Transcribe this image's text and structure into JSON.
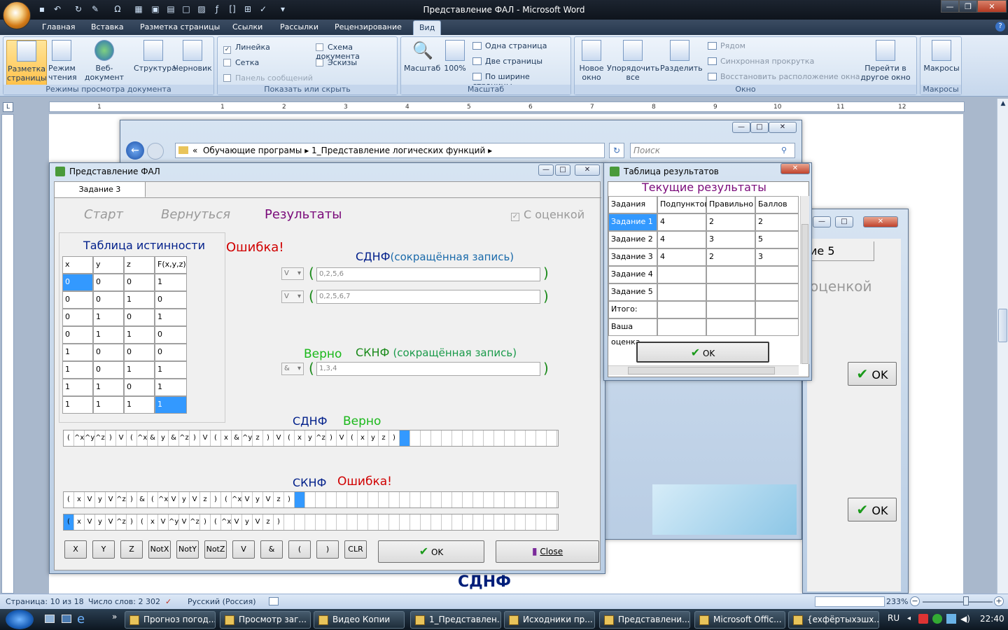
{
  "word": {
    "title": "Представление ФАЛ - Microsoft Word",
    "tabs": [
      "Главная",
      "Вставка",
      "Разметка страницы",
      "Ссылки",
      "Рассылки",
      "Рецензирование",
      "Вид"
    ],
    "selected_tab": "Вид",
    "groups": {
      "views": {
        "label": "Режимы просмотра документа",
        "buttons": [
          "Разметка страницы",
          "Режим чтения",
          "Веб-документ",
          "Структура",
          "Черновик"
        ]
      },
      "show": {
        "label": "Показать или скрыть",
        "items": [
          "Линейка",
          "Сетка",
          "Панель сообщений",
          "Схема документа",
          "Эскизы"
        ]
      },
      "zoom": {
        "label": "Масштаб",
        "zoom_btn": "Масштаб",
        "pct_btn": "100%",
        "one_page": "Одна страница",
        "two_pages": "Две страницы",
        "page_width": "По ширине страницы"
      },
      "window": {
        "label": "Окно",
        "new": "Новое окно",
        "arrange": "Упорядочить все",
        "split": "Разделить",
        "side": "Рядом",
        "sync": "Синхронная прокрутка",
        "reset": "Восстановить расположение окна",
        "switch": "Перейти в другое окно"
      },
      "macros": {
        "label": "Макросы",
        "btn": "Макросы"
      }
    },
    "ruler_numbers": [
      "1",
      "1",
      "2",
      "3",
      "4",
      "5",
      "6",
      "7",
      "8",
      "9",
      "10",
      "11",
      "12"
    ],
    "doc_text": "СДНФ",
    "status": {
      "page": "Страница: 10 из 18",
      "words": "Число слов: 2 302",
      "lang": "Русский (Россия)",
      "zoom": "233%"
    }
  },
  "explorer": {
    "crumbs": [
      "«",
      "Обучающие програмы",
      "1_Представление логических функций"
    ],
    "search_placeholder": "Поиск"
  },
  "back_window": {
    "tab_label": "ие 5",
    "check_label": "оценкой",
    "ok1": "OK",
    "ok2": "OK"
  },
  "fal": {
    "title": "Представление ФАЛ",
    "tab": "Задание 3",
    "nav": {
      "start": "Старт",
      "back": "Вернуться",
      "results": "Результаты",
      "rating": "С оценкой"
    },
    "truth_title": "Таблица истинности",
    "error_top": "Ошибка!",
    "headers": [
      "x",
      "y",
      "z",
      "F(x,y,z)"
    ],
    "rows": [
      [
        "0",
        "0",
        "0",
        "1"
      ],
      [
        "0",
        "0",
        "1",
        "0"
      ],
      [
        "0",
        "1",
        "0",
        "1"
      ],
      [
        "0",
        "1",
        "1",
        "0"
      ],
      [
        "1",
        "0",
        "0",
        "0"
      ],
      [
        "1",
        "0",
        "1",
        "1"
      ],
      [
        "1",
        "1",
        "0",
        "1"
      ],
      [
        "1",
        "1",
        "1",
        "1"
      ]
    ],
    "sdnf_label": "СДНФ",
    "short_note": "(сокращённая запись)",
    "sdnf_op1": "V",
    "sdnf_val1": "0,2,5,6",
    "sdnf_op2": "V",
    "sdnf_val2": "0,2,5,6,7",
    "correct1": "Верно",
    "sknf_label": "СКНФ",
    "sknf_op": "&",
    "sknf_val": "1,3,4",
    "row_sdnf_label": "СДНФ",
    "row_sdnf_status": "Верно",
    "row_sdnf": [
      "(",
      "^x",
      "^y",
      "^z",
      ")",
      "V",
      "(",
      "^x",
      "&",
      "y",
      "&",
      "^z",
      ")",
      "V",
      "(",
      "x",
      "&",
      "^y",
      "z",
      ")",
      "V",
      "(",
      "x",
      "y",
      "^z",
      ")",
      "V",
      "(",
      "x",
      "y",
      "z",
      ")"
    ],
    "row_sknf_label": "СКНФ",
    "row_sknf_status": "Ошибка!",
    "row_sknf1": [
      "(",
      "x",
      "V",
      "y",
      "V",
      "^z",
      ")",
      "&",
      "(",
      "^x",
      "V",
      "y",
      "V",
      "z",
      ")",
      "(",
      "^x",
      "V",
      "y",
      "V",
      "z",
      ")"
    ],
    "row_sknf2": [
      "(",
      "x",
      "V",
      "y",
      "V",
      "^z",
      ")",
      "(",
      "x",
      "V",
      "^y",
      "V",
      "^z",
      ")",
      "(",
      "^x",
      "V",
      "y",
      "V",
      "z",
      ")"
    ],
    "keys": [
      "X",
      "Y",
      "Z",
      "NotX",
      "NotY",
      "NotZ",
      "V",
      "&",
      "(",
      ")",
      "CLR"
    ],
    "ok": "OK",
    "close": "Close"
  },
  "results": {
    "title": "Таблица результатов",
    "heading": "Текущие результаты",
    "headers": [
      "Задания",
      "Подпунктов",
      "Правильно",
      "Баллов"
    ],
    "rows": [
      [
        "Задание 1",
        "4",
        "2",
        "2"
      ],
      [
        "Задание 2",
        "4",
        "3",
        "5"
      ],
      [
        "Задание 3",
        "4",
        "2",
        "3"
      ],
      [
        "Задание 4",
        "",
        "",
        ""
      ],
      [
        "Задание 5",
        "",
        "",
        ""
      ],
      [
        "Итого:",
        "",
        "",
        ""
      ],
      [
        "Ваша оценка",
        "",
        "",
        ""
      ]
    ],
    "ok": "OK"
  },
  "taskbar": {
    "items": [
      "Прогноз погод...",
      "Просмотр заг...",
      "Видео Копии",
      "1_Представлен...",
      "Исходники пр...",
      "Представлени...",
      "Microsoft Offic...",
      "{exфёртыхэшх..."
    ],
    "lang": "RU",
    "time": "22:40"
  }
}
